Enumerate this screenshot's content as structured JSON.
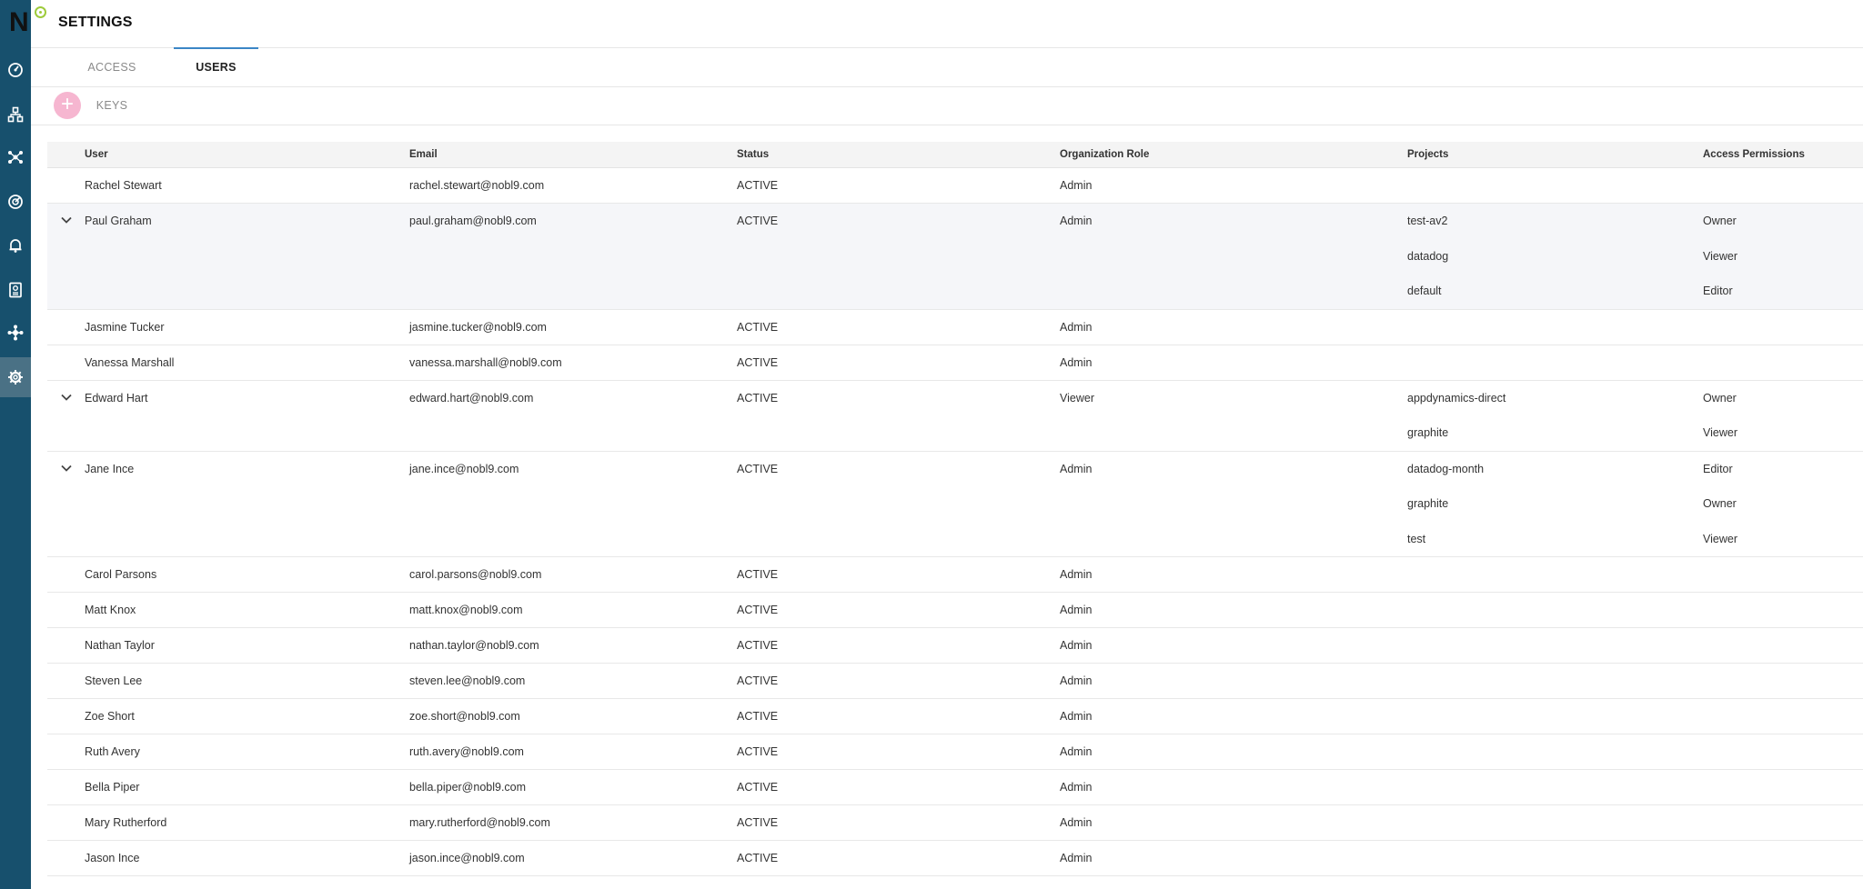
{
  "app": {
    "title": "SETTINGS",
    "logo_text": "N"
  },
  "sidebar": {
    "items": [
      {
        "icon": "dashboard-icon"
      },
      {
        "icon": "topology-icon"
      },
      {
        "icon": "network-icon"
      },
      {
        "icon": "target-icon"
      },
      {
        "icon": "bell-icon"
      },
      {
        "icon": "report-icon"
      },
      {
        "icon": "integrations-icon"
      },
      {
        "icon": "gear-icon",
        "active": true
      }
    ]
  },
  "tabs": [
    {
      "label": "ACCESS KEYS",
      "active": false
    },
    {
      "label": "USERS",
      "active": true
    }
  ],
  "toolbar": {
    "add_label": "+"
  },
  "table": {
    "columns": [
      "User",
      "Email",
      "Status",
      "Organization Role",
      "Projects",
      "Access Permissions"
    ],
    "rows": [
      {
        "user": "Rachel Stewart",
        "email": "rachel.stewart@nobl9.com",
        "status": "ACTIVE",
        "role": "Admin",
        "projects": [],
        "permissions": []
      },
      {
        "user": "Paul Graham",
        "email": "paul.graham@nobl9.com",
        "status": "ACTIVE",
        "role": "Admin",
        "expanded": true,
        "projects": [
          "test-av2",
          "datadog",
          "default"
        ],
        "permissions": [
          "Owner",
          "Viewer",
          "Editor"
        ]
      },
      {
        "user": "Jasmine Tucker",
        "email": "jasmine.tucker@nobl9.com",
        "status": "ACTIVE",
        "role": "Admin",
        "projects": [],
        "permissions": []
      },
      {
        "user": "Vanessa Marshall",
        "email": "vanessa.marshall@nobl9.com",
        "status": "ACTIVE",
        "role": "Admin",
        "projects": [],
        "permissions": []
      },
      {
        "user": "Edward Hart",
        "email": "edward.hart@nobl9.com",
        "status": "ACTIVE",
        "role": "Viewer",
        "projects": [
          "appdynamics-direct",
          "graphite"
        ],
        "permissions": [
          "Owner",
          "Viewer"
        ]
      },
      {
        "user": "Jane Ince",
        "email": "jane.ince@nobl9.com",
        "status": "ACTIVE",
        "role": "Admin",
        "projects": [
          "datadog-month",
          "graphite",
          "test"
        ],
        "permissions": [
          "Editor",
          "Owner",
          "Viewer"
        ]
      },
      {
        "user": "Carol Parsons",
        "email": "carol.parsons@nobl9.com",
        "status": "ACTIVE",
        "role": "Admin",
        "projects": [],
        "permissions": []
      },
      {
        "user": "Matt Knox",
        "email": "matt.knox@nobl9.com",
        "status": "ACTIVE",
        "role": "Admin",
        "projects": [],
        "permissions": []
      },
      {
        "user": "Nathan Taylor",
        "email": "nathan.taylor@nobl9.com",
        "status": "ACTIVE",
        "role": "Admin",
        "projects": [],
        "permissions": []
      },
      {
        "user": "Steven Lee",
        "email": "steven.lee@nobl9.com",
        "status": "ACTIVE",
        "role": "Admin",
        "projects": [],
        "permissions": []
      },
      {
        "user": "Zoe Short",
        "email": "zoe.short@nobl9.com",
        "status": "ACTIVE",
        "role": "Admin",
        "projects": [],
        "permissions": []
      },
      {
        "user": "Ruth Avery",
        "email": "ruth.avery@nobl9.com",
        "status": "ACTIVE",
        "role": "Admin",
        "projects": [],
        "permissions": []
      },
      {
        "user": "Bella Piper",
        "email": "bella.piper@nobl9.com",
        "status": "ACTIVE",
        "role": "Admin",
        "projects": [],
        "permissions": []
      },
      {
        "user": "Mary Rutherford",
        "email": "mary.rutherford@nobl9.com",
        "status": "ACTIVE",
        "role": "Admin",
        "projects": [],
        "permissions": []
      },
      {
        "user": "Jason Ince",
        "email": "jason.ince@nobl9.com",
        "status": "ACTIVE",
        "role": "Admin",
        "projects": [],
        "permissions": []
      }
    ]
  }
}
